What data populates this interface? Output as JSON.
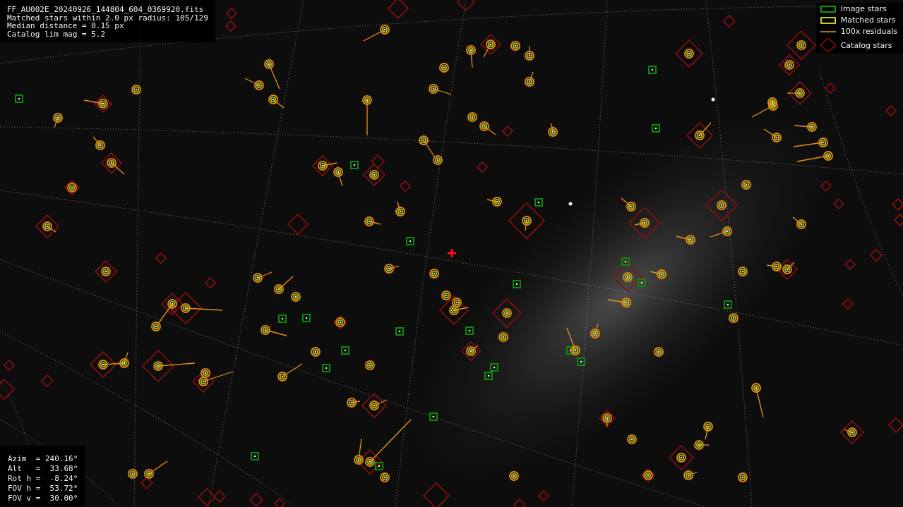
{
  "header": {
    "lines": [
      "FF_AU002E_20240926_144804_604_0369920.fits",
      "Matched stars within 2.0 px radius: 105/129",
      "Median distance = 0.15 px",
      "Catalog lim mag = 5.2"
    ]
  },
  "legend": [
    {
      "kind": "image",
      "label": "Image stars"
    },
    {
      "kind": "matched",
      "label": "Matched stars"
    },
    {
      "kind": "residual",
      "label": "100x residuals"
    },
    {
      "kind": "catalog",
      "label": "Catalog stars"
    }
  ],
  "pointing": {
    "lines": [
      "Azim  = 240.16°",
      "Alt   =  33.68°",
      "Rot h =  -8.24°",
      "FOV h =  53.72°",
      "FOV v =  30.00°"
    ]
  }
}
